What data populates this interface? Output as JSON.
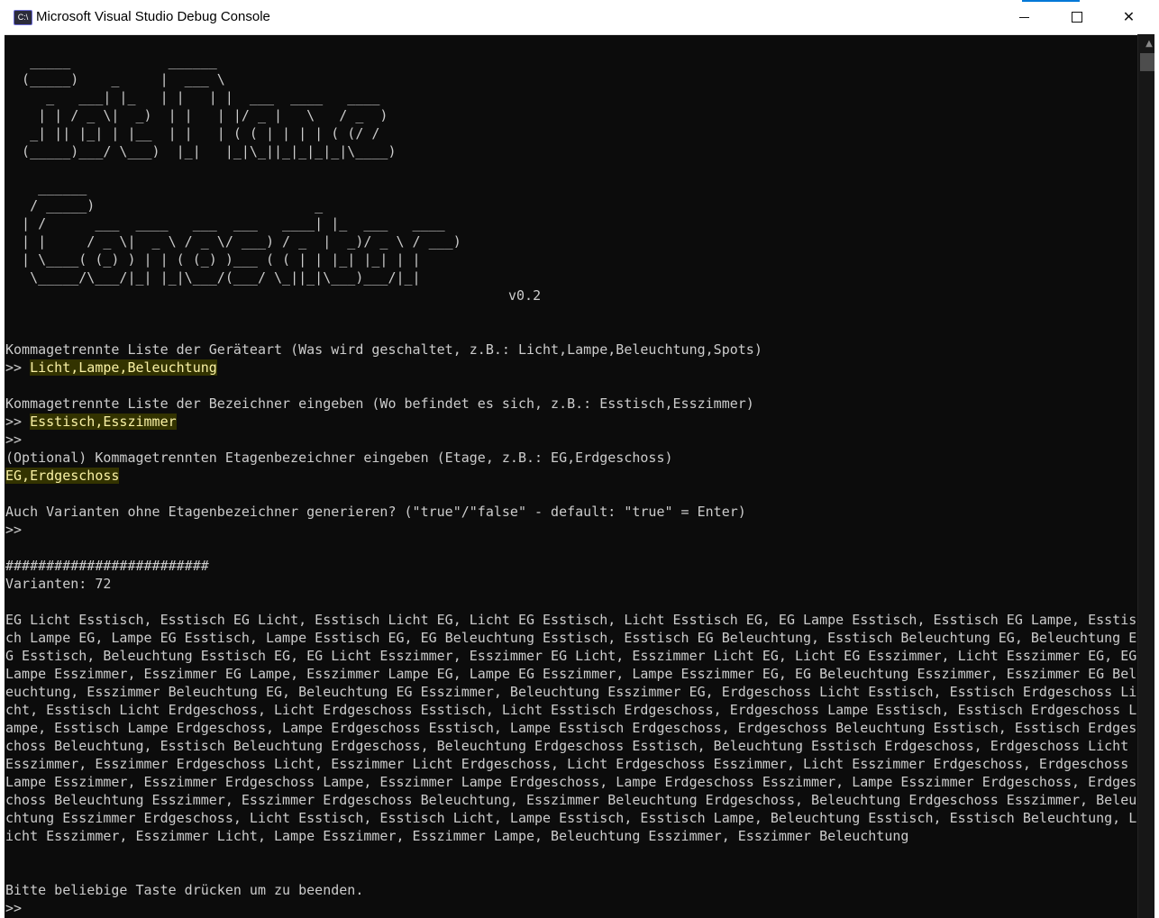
{
  "window": {
    "title": "Microsoft Visual Studio Debug Console",
    "icon_text": "C:\\"
  },
  "controls": {
    "minimize": "minimize-icon",
    "maximize": "maximize-icon",
    "close": "close-icon"
  },
  "banner": {
    "logo_lines": [
      "   _____            ______",
      "  (_____)    _     |  ___ \\",
      "     _   ___| |_   | |   | |  ___  ____   ____",
      "    | | / _ \\|  _)  | |   | |/ _ |   \\   / _  )",
      "   _| || |_| | |__  | |   | ( ( | | | | ( (/ /",
      "  (_____)___/ \\___)  |_|   |_|\\_||_|_|_|_|\\____)",
      "",
      "",
      "    ______",
      "   / _____)                           _",
      "  | /      ___  ____   ___  ___   ____| |_  ___   ____",
      "  | |     / _ \\|  _ \\ / _ \\/ ___) / _  |  _)/ _ \\ / ___)",
      "  | \\____( (_) ) | | ( (_) )___ ( ( | | |_| |_| | |",
      "   \\_____/\\___/|_| |_|\\___/(___/ \\_||_|\\___)___/|_|"
    ],
    "version": "v0.2"
  },
  "prompts": {
    "device_type_prompt": "Kommagetrennte Liste der Geräteart (Was wird geschaltet, z.B.: Licht,Lampe,Beleuchtung,Spots)",
    "device_type_marker": ">> ",
    "device_type_input": "Licht,Lampe,Beleuchtung",
    "name_prompt": "Kommagetrennte Liste der Bezeichner eingeben (Wo befindet es sich, z.B.: Esstisch,Esszimmer)",
    "name_marker": ">> ",
    "name_input": "Esstisch,Esszimmer",
    "name_empty_marker": ">>",
    "floor_prompt": "(Optional) Kommagetrennten Etagenbezeichner eingeben (Etage, z.B.: EG,Erdgeschoss)",
    "floor_input": "EG,Erdgeschoss",
    "variants_prompt": "Auch Varianten ohne Etagenbezeichner generieren? (\"true\"/\"false\" - default: \"true\" = Enter)",
    "variants_marker": ">>"
  },
  "result": {
    "separator": "#########################",
    "count_label": "Varianten: 72",
    "output": "EG Licht Esstisch, Esstisch EG Licht, Esstisch Licht EG, Licht EG Esstisch, Licht Esstisch EG, EG Lampe Esstisch, Esstisch EG Lampe, Esstisch Lampe EG, Lampe EG Esstisch, Lampe Esstisch EG, EG Beleuchtung Esstisch, Esstisch EG Beleuchtung, Esstisch Beleuchtung EG, Beleuchtung EG Esstisch, Beleuchtung Esstisch EG, EG Licht Esszimmer, Esszimmer EG Licht, Esszimmer Licht EG, Licht EG Esszimmer, Licht Esszimmer EG, EG Lampe Esszimmer, Esszimmer EG Lampe, Esszimmer Lampe EG, Lampe EG Esszimmer, Lampe Esszimmer EG, EG Beleuchtung Esszimmer, Esszimmer EG Beleuchtung, Esszimmer Beleuchtung EG, Beleuchtung EG Esszimmer, Beleuchtung Esszimmer EG, Erdgeschoss Licht Esstisch, Esstisch Erdgeschoss Licht, Esstisch Licht Erdgeschoss, Licht Erdgeschoss Esstisch, Licht Esstisch Erdgeschoss, Erdgeschoss Lampe Esstisch, Esstisch Erdgeschoss Lampe, Esstisch Lampe Erdgeschoss, Lampe Erdgeschoss Esstisch, Lampe Esstisch Erdgeschoss, Erdgeschoss Beleuchtung Esstisch, Esstisch Erdgeschoss Beleuchtung, Esstisch Beleuchtung Erdgeschoss, Beleuchtung Erdgeschoss Esstisch, Beleuchtung Esstisch Erdgeschoss, Erdgeschoss Licht Esszimmer, Esszimmer Erdgeschoss Licht, Esszimmer Licht Erdgeschoss, Licht Erdgeschoss Esszimmer, Licht Esszimmer Erdgeschoss, Erdgeschoss Lampe Esszimmer, Esszimmer Erdgeschoss Lampe, Esszimmer Lampe Erdgeschoss, Lampe Erdgeschoss Esszimmer, Lampe Esszimmer Erdgeschoss, Erdgeschoss Beleuchtung Esszimmer, Esszimmer Erdgeschoss Beleuchtung, Esszimmer Beleuchtung Erdgeschoss, Beleuchtung Erdgeschoss Esszimmer, Beleuchtung Esszimmer Erdgeschoss, Licht Esstisch, Esstisch Licht, Lampe Esstisch, Esstisch Lampe, Beleuchtung Esstisch, Esstisch Beleuchtung, Licht Esszimmer, Esszimmer Licht, Lampe Esszimmer, Esszimmer Lampe, Beleuchtung Esszimmer, Esszimmer Beleuchtung",
    "exit_prompt": "Bitte beliebige Taste drücken um zu beenden.",
    "exit_marker": ">>"
  },
  "colors": {
    "background": "#0c0c0c",
    "text": "#cccccc",
    "input_highlight": "#333300",
    "input_text": "#f9f1a5",
    "accent": "#0078d7"
  }
}
